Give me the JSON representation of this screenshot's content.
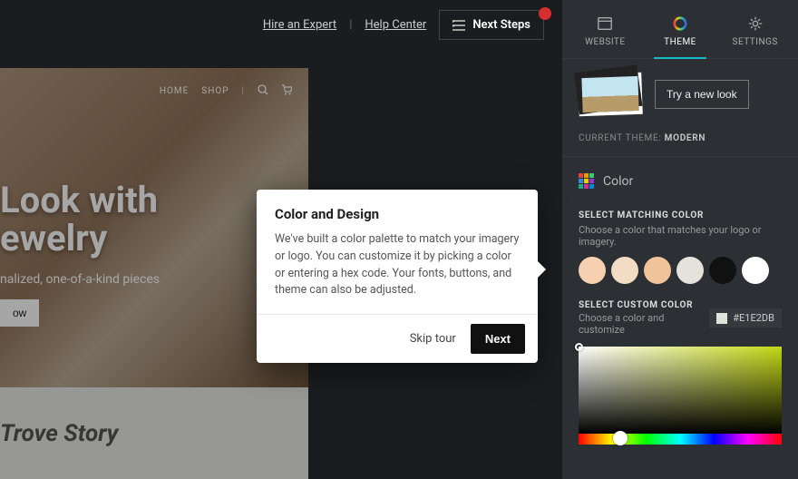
{
  "topbar": {
    "hire_link": "Hire an Expert",
    "help_link": "Help Center",
    "next_steps": "Next Steps"
  },
  "panel": {
    "tabs": {
      "website": "WEBSITE",
      "theme": "THEME",
      "settings": "SETTINGS"
    },
    "try_new_look": "Try a new look",
    "current_theme_label": "CURRENT THEME:",
    "current_theme_value": "MODERN",
    "color_heading": "Color",
    "matching": {
      "label": "SELECT MATCHING COLOR",
      "desc": "Choose a color that matches your logo or imagery.",
      "swatches": [
        "#f6d1b1",
        "#f2dcc3",
        "#f0c39a",
        "#e4e2da",
        "#111111",
        "#ffffff"
      ]
    },
    "custom": {
      "label": "SELECT CUSTOM COLOR",
      "desc": "Choose a color and customize",
      "hex": "#E1E2DB"
    }
  },
  "popover": {
    "title": "Color and Design",
    "body": "We've built a color palette to match your imagery or logo. You can customize it by picking a color or entering a hex code. Your fonts, buttons, and theme can also be adjusted.",
    "skip": "Skip tour",
    "next": "Next"
  },
  "hero": {
    "nav_home": "HOME",
    "nav_shop": "SHOP",
    "headline_a": "Look with",
    "headline_b": "ewelry",
    "subline": "nalized, one-of-a-kind pieces",
    "button": "ow",
    "story": "Trove Story"
  }
}
